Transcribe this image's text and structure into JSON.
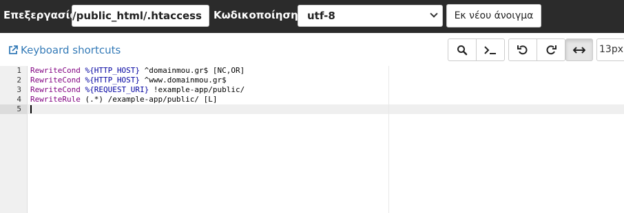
{
  "header": {
    "edit_label": "Επεξεργασία:",
    "file_path": "/home/domainmou/public_html/.htaccess",
    "encoding_label": "Κωδικοποίηση:",
    "encoding_value": "utf-8",
    "reopen_label": "Εκ νέου άνοιγμα"
  },
  "toolbar": {
    "shortcuts_label": "Keyboard shortcuts",
    "font_size": "13px",
    "buttons": [
      "search-icon",
      "terminal-icon",
      "undo-icon",
      "redo-icon",
      "wrap-icon"
    ],
    "active_button": "wrap-icon"
  },
  "editor": {
    "lines": [
      {
        "n": "1",
        "kw": "RewriteCond",
        "var": "%{HTTP_HOST}",
        "rest": " ^domainmou.gr$ [NC,OR]"
      },
      {
        "n": "2",
        "kw": "RewriteCond",
        "var": "%{HTTP_HOST}",
        "rest": " ^www.domainmou.gr$"
      },
      {
        "n": "3",
        "kw": "RewriteCond",
        "var": "%{REQUEST_URI}",
        "rest": " !example-app/public/"
      },
      {
        "n": "4",
        "kw": "RewriteRule",
        "var": "",
        "rest": " (.*) /example-app/public/ [L]"
      },
      {
        "n": "5",
        "kw": "",
        "var": "",
        "rest": ""
      }
    ],
    "active_line": 5
  },
  "colors": {
    "topbar": "#2b2b2b",
    "link": "#337ab7",
    "keyword": "#800080",
    "variable": "#0000a0"
  }
}
